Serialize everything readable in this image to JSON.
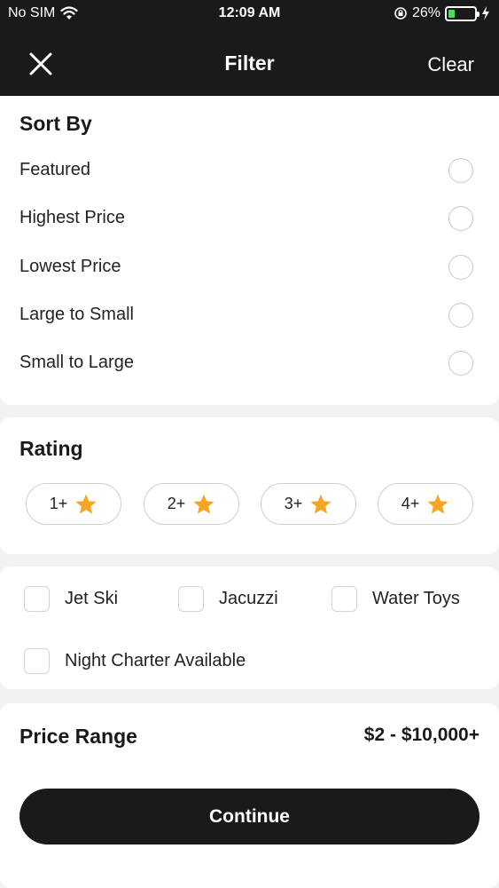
{
  "status_bar": {
    "carrier": "No SIM",
    "time": "12:09 AM",
    "battery": "26%",
    "battery_level": 0.26
  },
  "header": {
    "title": "Filter",
    "clear_label": "Clear",
    "close_icon": "close-icon"
  },
  "sort_by": {
    "title": "Sort By",
    "options": [
      "Featured",
      "Highest Price",
      "Lowest Price",
      "Large to Small",
      "Small to Large"
    ],
    "selected": null
  },
  "rating": {
    "title": "Rating",
    "chips": [
      "1+",
      "2+",
      "3+",
      "4+"
    ],
    "star_color": "#f5a623",
    "star_icon": "star-icon"
  },
  "amenities": {
    "items": [
      "Jet Ski",
      "Jacuzzi",
      "Water Toys",
      "Night Charter Available"
    ]
  },
  "price_range": {
    "title": "Price Range",
    "value": "$2 - $10,000+"
  },
  "continue_label": "Continue",
  "colors": {
    "dark": "#1b1a1a",
    "background": "#f2f2f2",
    "battery_green": "#4cd964"
  }
}
